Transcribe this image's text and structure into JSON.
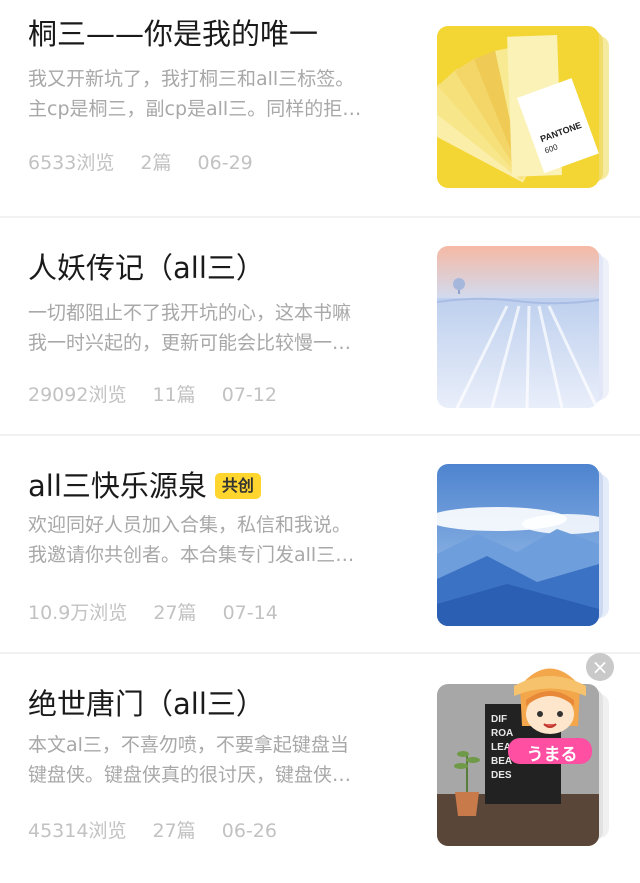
{
  "collections": [
    {
      "title": "桐三——你是我的唯一",
      "badge": "",
      "desc_line1": "我又开新坑了，我打桐三和all三标签。",
      "desc_line2": "主cp是桐三，副cp是all三。同样的拒…",
      "views": "6533浏览",
      "count": "2篇",
      "date": "06-29",
      "cover": "pantone-swatch-cover"
    },
    {
      "title": "人妖传记（all三）",
      "badge": "",
      "desc_line1": "一切都阻止不了我开坑的心，这本书嘛",
      "desc_line2": "我一时兴起的，更新可能会比较慢一…",
      "views": "29092浏览",
      "count": "11篇",
      "date": "07-12",
      "cover": "snow-field-cover"
    },
    {
      "title": "all三快乐源泉",
      "badge": "共创",
      "desc_line1": "欢迎同好人员加入合集，私信和我说。",
      "desc_line2": "我邀请你共创者。本合集专门发all三…",
      "views": "10.9万浏览",
      "count": "27篇",
      "date": "07-14",
      "cover": "blue-mountains-cover"
    },
    {
      "title": "绝世唐门（all三）",
      "badge": "",
      "desc_line1": "本文al三，不喜勿喷，不要拿起键盘当",
      "desc_line2": "键盘侠。键盘侠真的很讨厌，键盘侠…",
      "views": "45314浏览",
      "count": "27篇",
      "date": "06-26",
      "cover": "letter-board-plant-cover"
    }
  ],
  "sticker": {
    "text": "うまる",
    "icon": "umaru-sticker"
  },
  "close_icon": "×",
  "colors": {
    "badge": "#ffd52e",
    "meta_text": "#c2c2c2",
    "desc_text": "#a8a8a8"
  }
}
